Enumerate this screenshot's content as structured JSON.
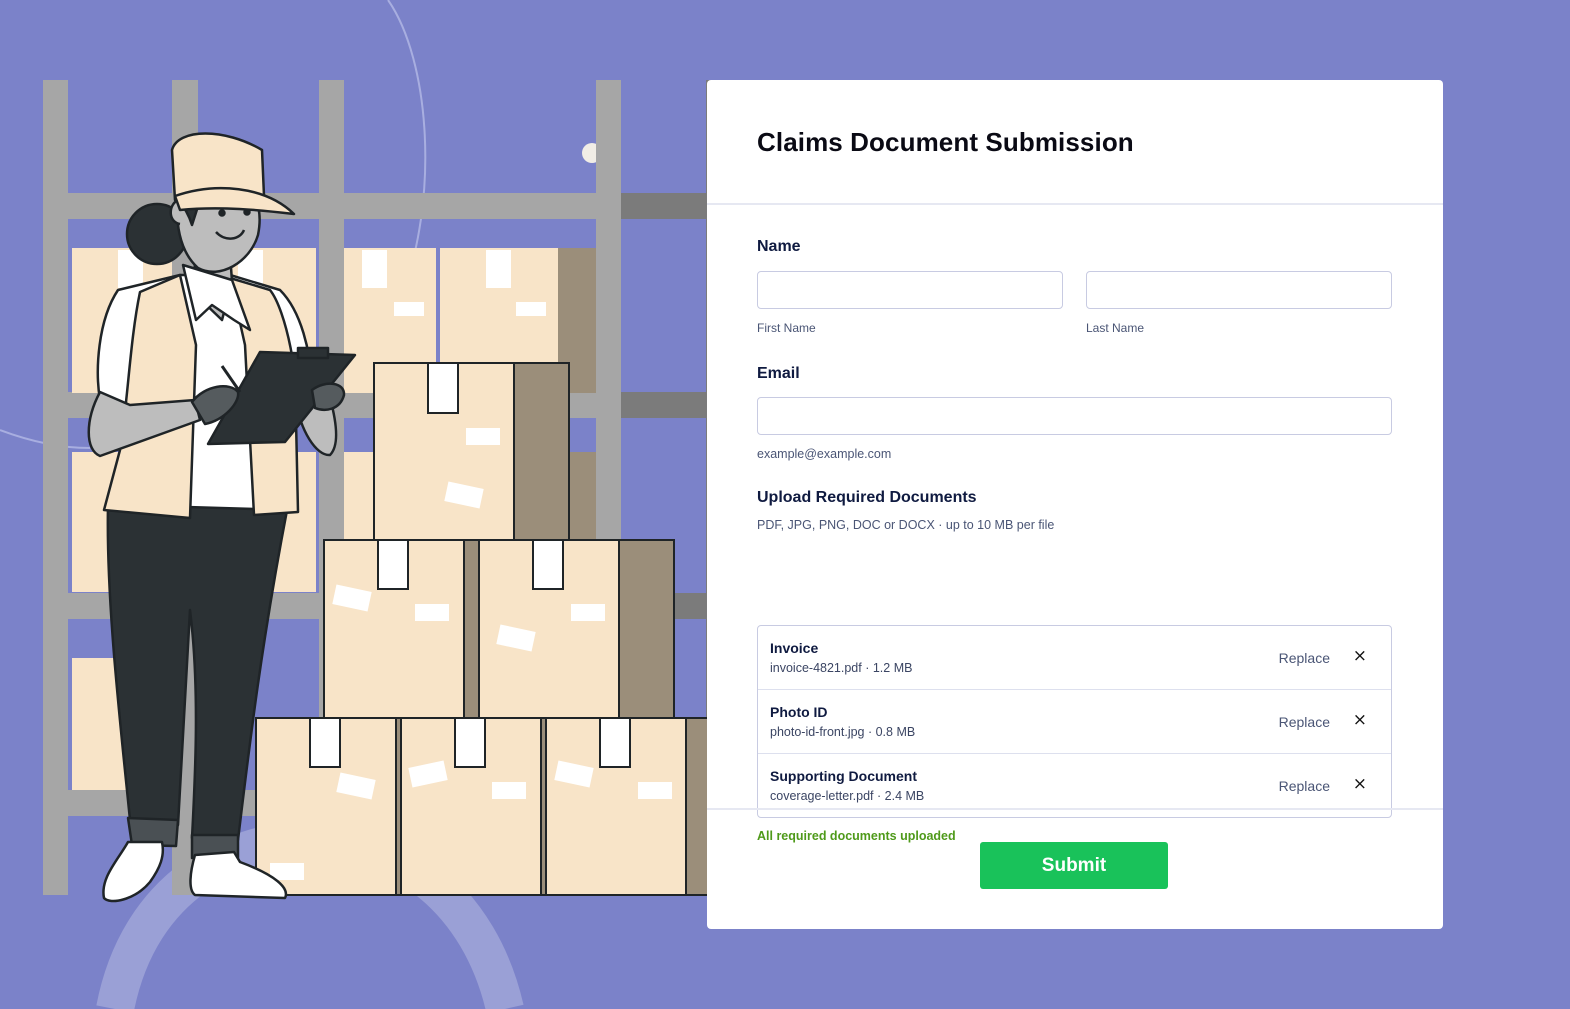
{
  "form": {
    "title": "Claims Document Submission",
    "name_label": "Name",
    "first_name": {
      "value": "",
      "sublabel": "First Name"
    },
    "last_name": {
      "value": "",
      "sublabel": "Last Name"
    },
    "email_label": "Email",
    "email": {
      "value": "",
      "help": "example@example.com"
    },
    "upload": {
      "label": "Upload Required Documents",
      "help": "PDF, JPG, PNG, DOC or DOCX · up to 10 MB per file",
      "files": [
        {
          "title": "Invoice",
          "meta": "invoice-4821.pdf · 1.2 MB",
          "replace": "Replace",
          "remove": "×"
        },
        {
          "title": "Photo ID",
          "meta": "photo-id-front.jpg · 0.8 MB",
          "replace": "Replace",
          "remove": "×"
        },
        {
          "title": "Supporting Document",
          "meta": "coverage-letter.pdf · 2.4 MB",
          "replace": "Replace",
          "remove": "×"
        }
      ],
      "status": "All required documents uploaded"
    },
    "submit_label": "Submit"
  },
  "colors": {
    "background": "#7b82c9",
    "submit": "#19c25a",
    "success": "#4f9a1a",
    "box": "#f8e4c8"
  },
  "illustration": {
    "icon": "warehouse-worker-illustration"
  }
}
